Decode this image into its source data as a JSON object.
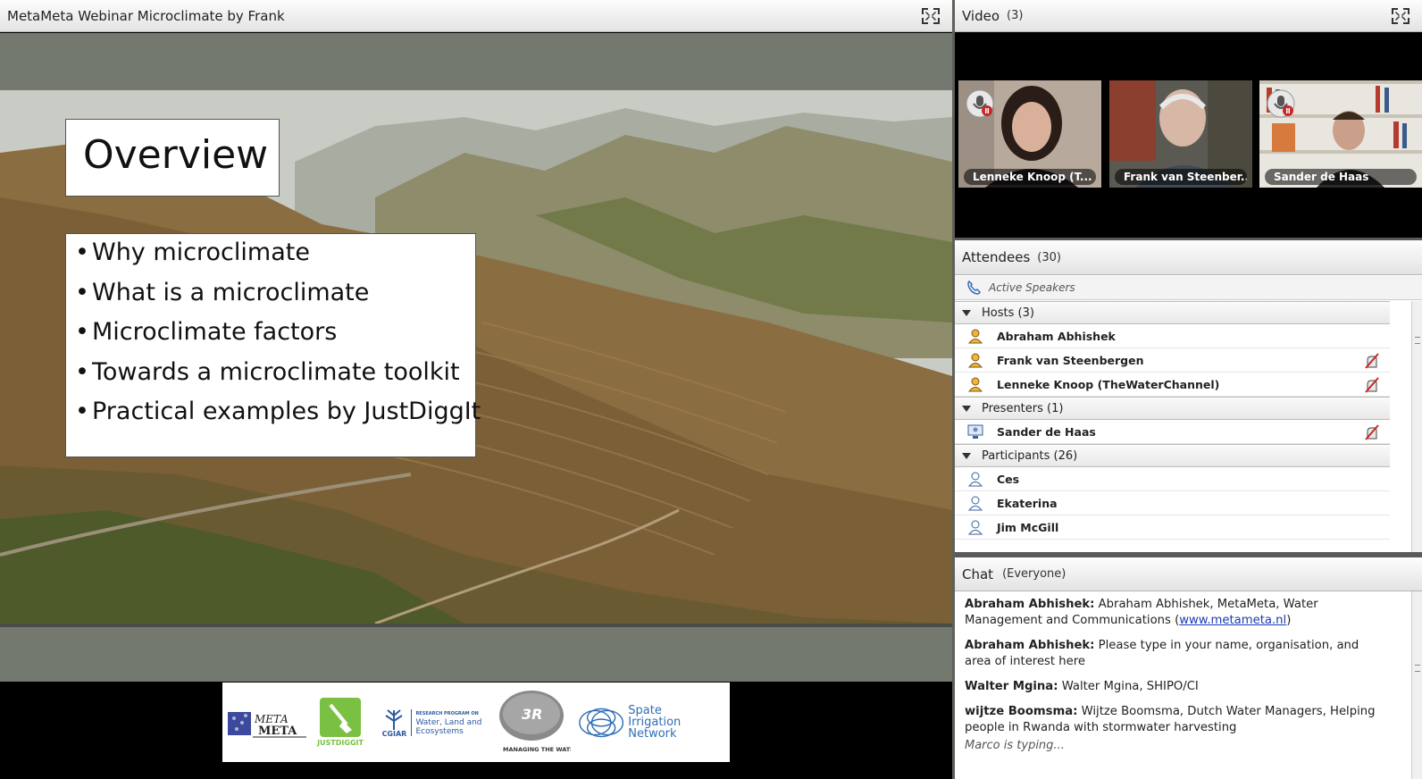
{
  "share": {
    "title": "MetaMeta Webinar Microclimate by Frank",
    "slide": {
      "heading": "Overview",
      "bullets": [
        "Why microclimate",
        "What is a microclimate",
        "Microclimate factors",
        "Towards a microclimate toolkit",
        "Practical examples by JustDiggIt"
      ]
    },
    "logos": {
      "metameta": "META META",
      "justdiggit": "JUSTDIGGIT",
      "cgiar": "CGIAR",
      "cgiar_program_small": "RESEARCH PROGRAM ON",
      "cgiar_program": [
        "Water, Land and",
        "Ecosystems"
      ],
      "threer": "3R",
      "threer_tagline": "MANAGING THE WATER BUFFER",
      "spate": [
        "Spate Irrigation",
        "Network"
      ]
    }
  },
  "video": {
    "title": "Video",
    "count": "(3)",
    "tiles": [
      {
        "name": "Lenneke Knoop (T..."
      },
      {
        "name": "Frank van Steenber..."
      },
      {
        "name": "Sander de Haas"
      }
    ]
  },
  "attendees": {
    "title": "Attendees",
    "count": "(30)",
    "active_speakers": "Active Speakers",
    "groups": {
      "hosts": {
        "label": "Hosts (3)",
        "members": [
          "Abraham Abhishek",
          "Frank van Steenbergen",
          "Lenneke Knoop (TheWaterChannel)"
        ]
      },
      "presenters": {
        "label": "Presenters (1)",
        "members": [
          "Sander de Haas"
        ]
      },
      "participants": {
        "label": "Participants (26)",
        "members": [
          "Ces",
          "Ekaterina",
          "Jim McGill"
        ]
      }
    }
  },
  "chat": {
    "title": "Chat",
    "scope": "(Everyone)",
    "messages": [
      {
        "sender": "Abraham Abhishek:",
        "text": "Abraham Abhishek, MetaMeta, Water Management and Communications (",
        "link": "www.metameta.nl",
        "after": ")"
      },
      {
        "sender": "Abraham Abhishek:",
        "text": "Please type in your name, organisation, and area of interest here"
      },
      {
        "sender": "Walter Mgina:",
        "text": "Walter Mgina, SHIPO/CI"
      },
      {
        "sender": "wijtze Boomsma:",
        "text": "Wijtze Boomsma, Dutch Water Managers, Helping people in Rwanda with stormwater harvesting"
      }
    ],
    "typing": "Marco is typing..."
  },
  "colors": {
    "header_bg": "#e9e9e9",
    "link": "#1a3bb3",
    "spate_blue": "#2f6fb5",
    "justdiggit_green": "#7ac143"
  }
}
